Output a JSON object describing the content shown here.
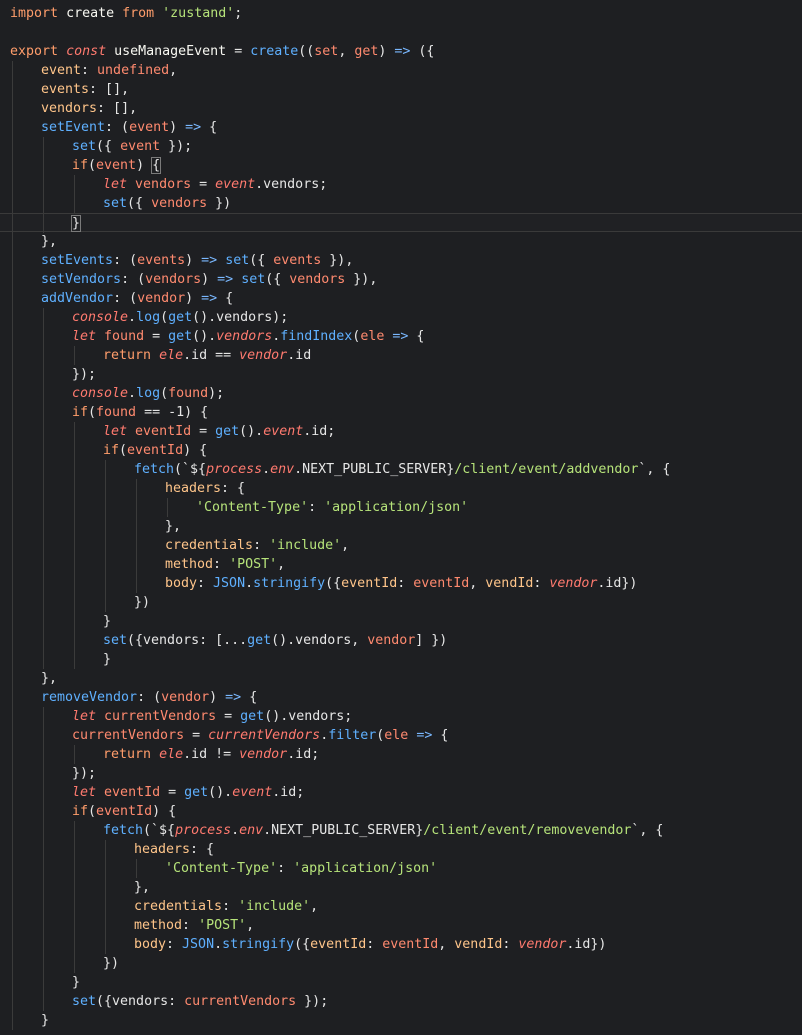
{
  "colors": {
    "background": "#1e1f22",
    "keyword": "#ff9d6b",
    "identifier": "#f8f8f2",
    "function": "#5fb0ff",
    "parameter": "#ff8a6f",
    "string": "#b6e37a",
    "italic_keyword": "#ff7a6f",
    "property": "#ffc58a",
    "punctuation": "#e6e6e6",
    "arrow": "#7ab8ff"
  },
  "code_lines": [
    {
      "indent": 0,
      "tokens": [
        [
          "import",
          "keyword"
        ],
        [
          " ",
          "plain"
        ],
        [
          "create",
          "identifier"
        ],
        [
          " ",
          "plain"
        ],
        [
          "from",
          "keyword"
        ],
        [
          " ",
          "plain"
        ],
        [
          "'zustand'",
          "string"
        ],
        [
          ";",
          "punctuation"
        ]
      ]
    },
    {
      "indent": 0,
      "tokens": []
    },
    {
      "indent": 0,
      "tokens": [
        [
          "export",
          "keyword"
        ],
        [
          " ",
          "plain"
        ],
        [
          "const",
          "italic_keyword"
        ],
        [
          " ",
          "plain"
        ],
        [
          "useManageEvent",
          "identifier"
        ],
        [
          " = ",
          "punctuation"
        ],
        [
          "create",
          "function"
        ],
        [
          "((",
          "punctuation"
        ],
        [
          "set",
          "parameter"
        ],
        [
          ", ",
          "punctuation"
        ],
        [
          "get",
          "parameter"
        ],
        [
          ") ",
          "punctuation"
        ],
        [
          "=>",
          "arrow"
        ],
        [
          " ({",
          "punctuation"
        ]
      ]
    },
    {
      "indent": 1,
      "tokens": [
        [
          "event",
          "property"
        ],
        [
          ": ",
          "punctuation"
        ],
        [
          "undefined",
          "parameter"
        ],
        [
          ",",
          "punctuation"
        ]
      ]
    },
    {
      "indent": 1,
      "tokens": [
        [
          "events",
          "property"
        ],
        [
          ": [],",
          "punctuation"
        ]
      ]
    },
    {
      "indent": 1,
      "tokens": [
        [
          "vendors",
          "property"
        ],
        [
          ": [],",
          "punctuation"
        ]
      ]
    },
    {
      "indent": 1,
      "tokens": [
        [
          "setEvent",
          "function"
        ],
        [
          ": (",
          "punctuation"
        ],
        [
          "event",
          "parameter"
        ],
        [
          ") ",
          "punctuation"
        ],
        [
          "=>",
          "arrow"
        ],
        [
          " {",
          "punctuation"
        ]
      ]
    },
    {
      "indent": 2,
      "tokens": [
        [
          "set",
          "function"
        ],
        [
          "({ ",
          "punctuation"
        ],
        [
          "event",
          "parameter"
        ],
        [
          " });",
          "punctuation"
        ]
      ]
    },
    {
      "indent": 2,
      "tokens": [
        [
          "if",
          "keyword"
        ],
        [
          "(",
          "punctuation"
        ],
        [
          "event",
          "parameter"
        ],
        [
          ") ",
          "punctuation"
        ],
        [
          "{",
          "bracket"
        ]
      ]
    },
    {
      "indent": 3,
      "tokens": [
        [
          "let",
          "italic_keyword"
        ],
        [
          " ",
          "plain"
        ],
        [
          "vendors",
          "parameter"
        ],
        [
          " = ",
          "punctuation"
        ],
        [
          "event",
          "italic_keyword"
        ],
        [
          ".vendors;",
          "punctuation"
        ]
      ]
    },
    {
      "indent": 3,
      "tokens": [
        [
          "set",
          "function"
        ],
        [
          "({ ",
          "punctuation"
        ],
        [
          "vendors",
          "parameter"
        ],
        [
          " })",
          "punctuation"
        ]
      ]
    },
    {
      "indent": 2,
      "tokens": [
        [
          "}",
          "bracket"
        ]
      ],
      "current": true
    },
    {
      "indent": 1,
      "tokens": [
        [
          "},",
          "punctuation"
        ]
      ]
    },
    {
      "indent": 1,
      "tokens": [
        [
          "setEvents",
          "function"
        ],
        [
          ": (",
          "punctuation"
        ],
        [
          "events",
          "parameter"
        ],
        [
          ") ",
          "punctuation"
        ],
        [
          "=>",
          "arrow"
        ],
        [
          " ",
          "plain"
        ],
        [
          "set",
          "function"
        ],
        [
          "({ ",
          "punctuation"
        ],
        [
          "events",
          "parameter"
        ],
        [
          " }),",
          "punctuation"
        ]
      ]
    },
    {
      "indent": 1,
      "tokens": [
        [
          "setVendors",
          "function"
        ],
        [
          ": (",
          "punctuation"
        ],
        [
          "vendors",
          "parameter"
        ],
        [
          ") ",
          "punctuation"
        ],
        [
          "=>",
          "arrow"
        ],
        [
          " ",
          "plain"
        ],
        [
          "set",
          "function"
        ],
        [
          "({ ",
          "punctuation"
        ],
        [
          "vendors",
          "parameter"
        ],
        [
          " }),",
          "punctuation"
        ]
      ]
    },
    {
      "indent": 1,
      "tokens": [
        [
          "addVendor",
          "function"
        ],
        [
          ": (",
          "punctuation"
        ],
        [
          "vendor",
          "parameter"
        ],
        [
          ") ",
          "punctuation"
        ],
        [
          "=>",
          "arrow"
        ],
        [
          " {",
          "punctuation"
        ]
      ]
    },
    {
      "indent": 2,
      "tokens": [
        [
          "console",
          "italic_keyword"
        ],
        [
          ".",
          "punctuation"
        ],
        [
          "log",
          "function"
        ],
        [
          "(",
          "punctuation"
        ],
        [
          "get",
          "function"
        ],
        [
          "().vendors);",
          "punctuation"
        ]
      ]
    },
    {
      "indent": 2,
      "tokens": [
        [
          "let",
          "italic_keyword"
        ],
        [
          " ",
          "plain"
        ],
        [
          "found",
          "parameter"
        ],
        [
          " = ",
          "punctuation"
        ],
        [
          "get",
          "function"
        ],
        [
          "().",
          "punctuation"
        ],
        [
          "vendors",
          "italic_keyword"
        ],
        [
          ".",
          "punctuation"
        ],
        [
          "findIndex",
          "function"
        ],
        [
          "(",
          "punctuation"
        ],
        [
          "ele",
          "parameter"
        ],
        [
          " ",
          "plain"
        ],
        [
          "=>",
          "arrow"
        ],
        [
          " {",
          "punctuation"
        ]
      ]
    },
    {
      "indent": 3,
      "tokens": [
        [
          "return",
          "keyword"
        ],
        [
          " ",
          "plain"
        ],
        [
          "ele",
          "italic_keyword"
        ],
        [
          ".id == ",
          "punctuation"
        ],
        [
          "vendor",
          "italic_keyword"
        ],
        [
          ".id",
          "punctuation"
        ]
      ]
    },
    {
      "indent": 2,
      "tokens": [
        [
          "});",
          "punctuation"
        ]
      ]
    },
    {
      "indent": 2,
      "tokens": [
        [
          "console",
          "italic_keyword"
        ],
        [
          ".",
          "punctuation"
        ],
        [
          "log",
          "function"
        ],
        [
          "(",
          "punctuation"
        ],
        [
          "found",
          "parameter"
        ],
        [
          ");",
          "punctuation"
        ]
      ]
    },
    {
      "indent": 2,
      "tokens": [
        [
          "if",
          "keyword"
        ],
        [
          "(",
          "punctuation"
        ],
        [
          "found",
          "parameter"
        ],
        [
          " == -1) {",
          "punctuation"
        ]
      ]
    },
    {
      "indent": 3,
      "tokens": [
        [
          "let",
          "italic_keyword"
        ],
        [
          " ",
          "plain"
        ],
        [
          "eventId",
          "parameter"
        ],
        [
          " = ",
          "punctuation"
        ],
        [
          "get",
          "function"
        ],
        [
          "().",
          "punctuation"
        ],
        [
          "event",
          "italic_keyword"
        ],
        [
          ".id;",
          "punctuation"
        ]
      ]
    },
    {
      "indent": 3,
      "tokens": [
        [
          "if",
          "keyword"
        ],
        [
          "(",
          "punctuation"
        ],
        [
          "eventId",
          "parameter"
        ],
        [
          ") {",
          "punctuation"
        ]
      ]
    },
    {
      "indent": 4,
      "tokens": [
        [
          "fetch",
          "function"
        ],
        [
          "(`${",
          "punctuation"
        ],
        [
          "process",
          "italic_keyword"
        ],
        [
          ".",
          "punctuation"
        ],
        [
          "env",
          "italic_keyword"
        ],
        [
          ".NEXT_PUBLIC_SERVER}",
          "punctuation"
        ],
        [
          "/client/event/addvendor",
          "string"
        ],
        [
          "`, {",
          "punctuation"
        ]
      ]
    },
    {
      "indent": 5,
      "tokens": [
        [
          "headers",
          "property"
        ],
        [
          ": {",
          "punctuation"
        ]
      ]
    },
    {
      "indent": 6,
      "tokens": [
        [
          "'Content-Type'",
          "string"
        ],
        [
          ": ",
          "punctuation"
        ],
        [
          "'application/json'",
          "string"
        ]
      ]
    },
    {
      "indent": 5,
      "tokens": [
        [
          "},",
          "punctuation"
        ]
      ]
    },
    {
      "indent": 5,
      "tokens": [
        [
          "credentials",
          "property"
        ],
        [
          ": ",
          "punctuation"
        ],
        [
          "'include'",
          "string"
        ],
        [
          ",",
          "punctuation"
        ]
      ]
    },
    {
      "indent": 5,
      "tokens": [
        [
          "method",
          "property"
        ],
        [
          ": ",
          "punctuation"
        ],
        [
          "'POST'",
          "string"
        ],
        [
          ",",
          "punctuation"
        ]
      ]
    },
    {
      "indent": 5,
      "tokens": [
        [
          "body",
          "property"
        ],
        [
          ": ",
          "punctuation"
        ],
        [
          "JSON",
          "function"
        ],
        [
          ".",
          "punctuation"
        ],
        [
          "stringify",
          "function"
        ],
        [
          "({",
          "punctuation"
        ],
        [
          "eventId",
          "property"
        ],
        [
          ": ",
          "punctuation"
        ],
        [
          "eventId",
          "parameter"
        ],
        [
          ", ",
          "punctuation"
        ],
        [
          "vendId",
          "property"
        ],
        [
          ": ",
          "punctuation"
        ],
        [
          "vendor",
          "italic_keyword"
        ],
        [
          ".id})",
          "punctuation"
        ]
      ]
    },
    {
      "indent": 4,
      "tokens": [
        [
          "})",
          "punctuation"
        ]
      ]
    },
    {
      "indent": 3,
      "tokens": [
        [
          "}",
          "punctuation"
        ]
      ]
    },
    {
      "indent": 3,
      "tokens": [
        [
          "set",
          "function"
        ],
        [
          "({vendors: [...",
          "punctuation"
        ],
        [
          "get",
          "function"
        ],
        [
          "().vendors, ",
          "punctuation"
        ],
        [
          "vendor",
          "parameter"
        ],
        [
          "] })",
          "punctuation"
        ]
      ]
    },
    {
      "indent": 3,
      "tokens": [
        [
          "}",
          "punctuation"
        ]
      ]
    },
    {
      "indent": 1,
      "tokens": [
        [
          "},",
          "punctuation"
        ]
      ]
    },
    {
      "indent": 1,
      "tokens": [
        [
          "removeVendor",
          "function"
        ],
        [
          ": (",
          "punctuation"
        ],
        [
          "vendor",
          "parameter"
        ],
        [
          ") ",
          "punctuation"
        ],
        [
          "=>",
          "arrow"
        ],
        [
          " {",
          "punctuation"
        ]
      ]
    },
    {
      "indent": 2,
      "tokens": [
        [
          "let",
          "italic_keyword"
        ],
        [
          " ",
          "plain"
        ],
        [
          "currentVendors",
          "parameter"
        ],
        [
          " = ",
          "punctuation"
        ],
        [
          "get",
          "function"
        ],
        [
          "().vendors;",
          "punctuation"
        ]
      ]
    },
    {
      "indent": 2,
      "tokens": [
        [
          "currentVendors",
          "parameter"
        ],
        [
          " = ",
          "punctuation"
        ],
        [
          "currentVendors",
          "italic_keyword"
        ],
        [
          ".",
          "punctuation"
        ],
        [
          "filter",
          "function"
        ],
        [
          "(",
          "punctuation"
        ],
        [
          "ele",
          "parameter"
        ],
        [
          " ",
          "plain"
        ],
        [
          "=>",
          "arrow"
        ],
        [
          " {",
          "punctuation"
        ]
      ]
    },
    {
      "indent": 3,
      "tokens": [
        [
          "return",
          "keyword"
        ],
        [
          " ",
          "plain"
        ],
        [
          "ele",
          "italic_keyword"
        ],
        [
          ".id != ",
          "punctuation"
        ],
        [
          "vendor",
          "italic_keyword"
        ],
        [
          ".id;",
          "punctuation"
        ]
      ]
    },
    {
      "indent": 2,
      "tokens": [
        [
          "});",
          "punctuation"
        ]
      ]
    },
    {
      "indent": 2,
      "tokens": [
        [
          "let",
          "italic_keyword"
        ],
        [
          " ",
          "plain"
        ],
        [
          "eventId",
          "parameter"
        ],
        [
          " = ",
          "punctuation"
        ],
        [
          "get",
          "function"
        ],
        [
          "().",
          "punctuation"
        ],
        [
          "event",
          "italic_keyword"
        ],
        [
          ".id;",
          "punctuation"
        ]
      ]
    },
    {
      "indent": 2,
      "tokens": [
        [
          "if",
          "keyword"
        ],
        [
          "(",
          "punctuation"
        ],
        [
          "eventId",
          "parameter"
        ],
        [
          ") {",
          "punctuation"
        ]
      ]
    },
    {
      "indent": 3,
      "tokens": [
        [
          "fetch",
          "function"
        ],
        [
          "(`${",
          "punctuation"
        ],
        [
          "process",
          "italic_keyword"
        ],
        [
          ".",
          "punctuation"
        ],
        [
          "env",
          "italic_keyword"
        ],
        [
          ".NEXT_PUBLIC_SERVER}",
          "punctuation"
        ],
        [
          "/client/event/removevendor",
          "string"
        ],
        [
          "`, {",
          "punctuation"
        ]
      ]
    },
    {
      "indent": 4,
      "tokens": [
        [
          "headers",
          "property"
        ],
        [
          ": {",
          "punctuation"
        ]
      ]
    },
    {
      "indent": 5,
      "tokens": [
        [
          "'Content-Type'",
          "string"
        ],
        [
          ": ",
          "punctuation"
        ],
        [
          "'application/json'",
          "string"
        ]
      ]
    },
    {
      "indent": 4,
      "tokens": [
        [
          "},",
          "punctuation"
        ]
      ]
    },
    {
      "indent": 4,
      "tokens": [
        [
          "credentials",
          "property"
        ],
        [
          ": ",
          "punctuation"
        ],
        [
          "'include'",
          "string"
        ],
        [
          ",",
          "punctuation"
        ]
      ]
    },
    {
      "indent": 4,
      "tokens": [
        [
          "method",
          "property"
        ],
        [
          ": ",
          "punctuation"
        ],
        [
          "'POST'",
          "string"
        ],
        [
          ",",
          "punctuation"
        ]
      ]
    },
    {
      "indent": 4,
      "tokens": [
        [
          "body",
          "property"
        ],
        [
          ": ",
          "punctuation"
        ],
        [
          "JSON",
          "function"
        ],
        [
          ".",
          "punctuation"
        ],
        [
          "stringify",
          "function"
        ],
        [
          "({",
          "punctuation"
        ],
        [
          "eventId",
          "property"
        ],
        [
          ": ",
          "punctuation"
        ],
        [
          "eventId",
          "parameter"
        ],
        [
          ", ",
          "punctuation"
        ],
        [
          "vendId",
          "property"
        ],
        [
          ": ",
          "punctuation"
        ],
        [
          "vendor",
          "italic_keyword"
        ],
        [
          ".id})",
          "punctuation"
        ]
      ]
    },
    {
      "indent": 3,
      "tokens": [
        [
          "})",
          "punctuation"
        ]
      ]
    },
    {
      "indent": 2,
      "tokens": [
        [
          "}",
          "punctuation"
        ]
      ]
    },
    {
      "indent": 2,
      "tokens": [
        [
          "set",
          "function"
        ],
        [
          "({vendors: ",
          "punctuation"
        ],
        [
          "currentVendors",
          "parameter"
        ],
        [
          " });",
          "punctuation"
        ]
      ]
    },
    {
      "indent": 1,
      "tokens": [
        [
          "}",
          "punctuation"
        ]
      ]
    }
  ]
}
